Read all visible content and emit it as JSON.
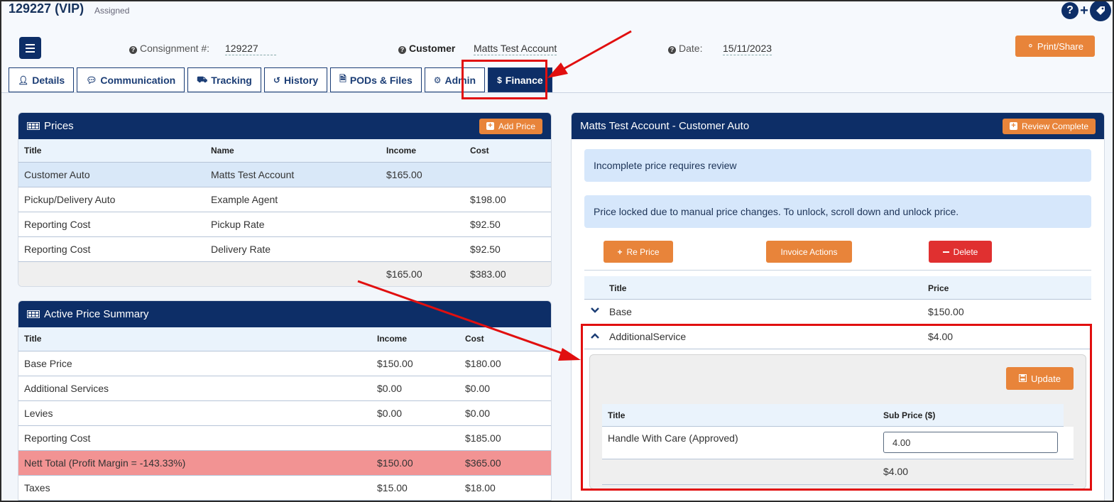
{
  "header": {
    "consignment_title": "129227 (VIP)",
    "status": "Assigned",
    "consignment_label": "Consignment #:",
    "consignment_value": "129227",
    "customer_label": "Customer",
    "customer_value": "Matts Test Account",
    "date_label": "Date:",
    "date_value": "15/11/2023",
    "print_share_label": "Print/Share",
    "help_icon": "?",
    "plus_icon": "+"
  },
  "tabs": [
    {
      "label": "Details",
      "icon": "user-icon"
    },
    {
      "label": "Communication",
      "icon": "comment-icon"
    },
    {
      "label": "Tracking",
      "icon": "truck-icon"
    },
    {
      "label": "History",
      "icon": "history-icon"
    },
    {
      "label": "PODs & Files",
      "icon": "file-icon"
    },
    {
      "label": "Admin",
      "icon": "gear-icon"
    },
    {
      "label": "Finance",
      "icon": "dollar-icon",
      "active": true
    }
  ],
  "prices": {
    "title": "Prices",
    "add_label": "Add Price",
    "columns": [
      "Title",
      "Name",
      "Income",
      "Cost"
    ],
    "rows": [
      [
        "Customer Auto",
        "Matts Test Account",
        "$165.00",
        ""
      ],
      [
        "Pickup/Delivery Auto",
        "Example Agent",
        "",
        "$198.00"
      ],
      [
        "Reporting Cost",
        "Pickup Rate",
        "",
        "$92.50"
      ],
      [
        "Reporting Cost",
        "Delivery Rate",
        "",
        "$92.50"
      ]
    ],
    "totals": [
      "",
      "",
      "$165.00",
      "$383.00"
    ]
  },
  "summary": {
    "title": "Active Price Summary",
    "columns": [
      "Title",
      "Income",
      "Cost"
    ],
    "rows": [
      [
        "Base Price",
        "$150.00",
        "$180.00"
      ],
      [
        "Additional Services",
        "$0.00",
        "$0.00"
      ],
      [
        "Levies",
        "$0.00",
        "$0.00"
      ],
      [
        "Reporting Cost",
        "",
        "$185.00"
      ],
      [
        "Nett Total (Profit Margin = -143.33%)",
        "$150.00",
        "$365.00"
      ],
      [
        "Taxes",
        "$15.00",
        "$18.00"
      ]
    ]
  },
  "detail": {
    "title": "Matts Test Account - Customer Auto",
    "review_label": "Review Complete",
    "alert1": "Incomplete price requires review",
    "alert2": "Price locked due to manual price changes. To unlock, scroll down and unlock price.",
    "reprice_label": "Re Price",
    "invoice_label": "Invoice Actions",
    "delete_label": "Delete",
    "col_title": "Title",
    "col_price": "Price",
    "items": [
      {
        "title": "Base",
        "price": "$150.00",
        "expanded": false
      },
      {
        "title": "AdditionalService",
        "price": "$4.00",
        "expanded": true
      }
    ],
    "update_label": "Update",
    "sub_col_title": "Title",
    "sub_col_price": "Sub Price ($)",
    "sub_item_title": "Handle With Care (Approved)",
    "sub_item_value": "4.00",
    "sub_total": "$4.00"
  },
  "colors": {
    "navy": "#0d2e67",
    "orange": "#e8843a",
    "danger": "#e03030",
    "annotation_red": "#e10f0f",
    "nett_row": "#f29393"
  }
}
